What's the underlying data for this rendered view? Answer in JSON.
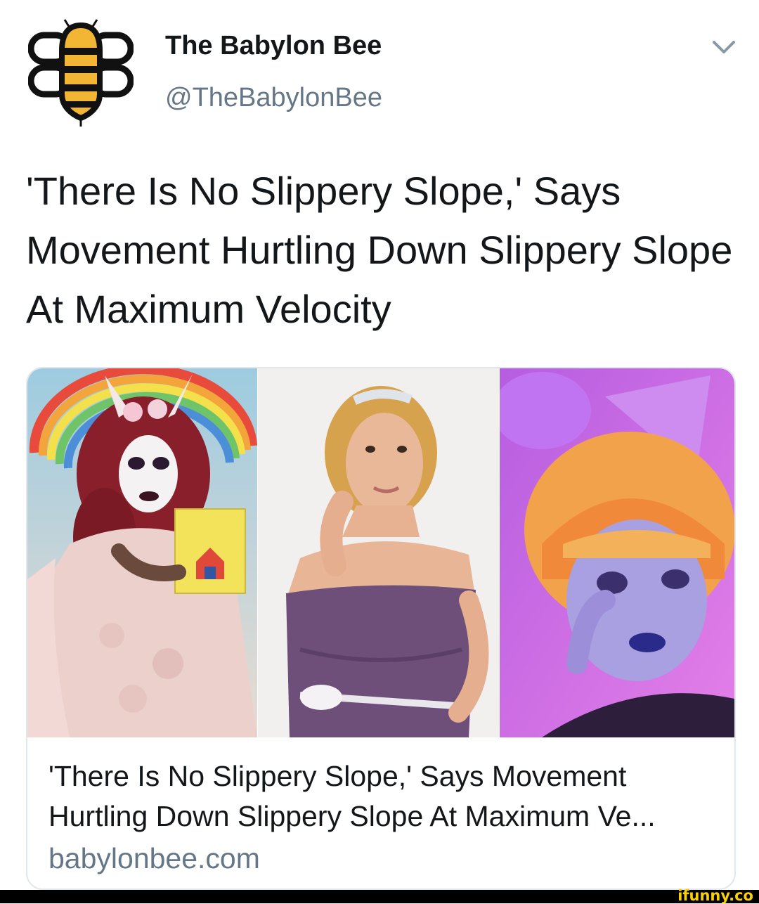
{
  "tweet": {
    "author": {
      "display_name": "The Babylon Bee",
      "handle": "@TheBabylonBee",
      "avatar_icon": "bee-logo-icon"
    },
    "menu_icon": "chevron-down-icon",
    "text": "'There Is No Slippery Slope,' Says Movement Hurtling Down Slippery Slope At Maximum Velocity"
  },
  "card": {
    "title": "'There Is No Slippery Slope,' Says Movement Hurtling Down Slippery Slope At Maximum Ve...",
    "domain": "babylonbee.com"
  },
  "watermark": "ifunny.co",
  "colors": {
    "text": "#14171a",
    "secondary": "#657786",
    "border": "#e1e8ed",
    "bee_yellow": "#f2b634"
  }
}
